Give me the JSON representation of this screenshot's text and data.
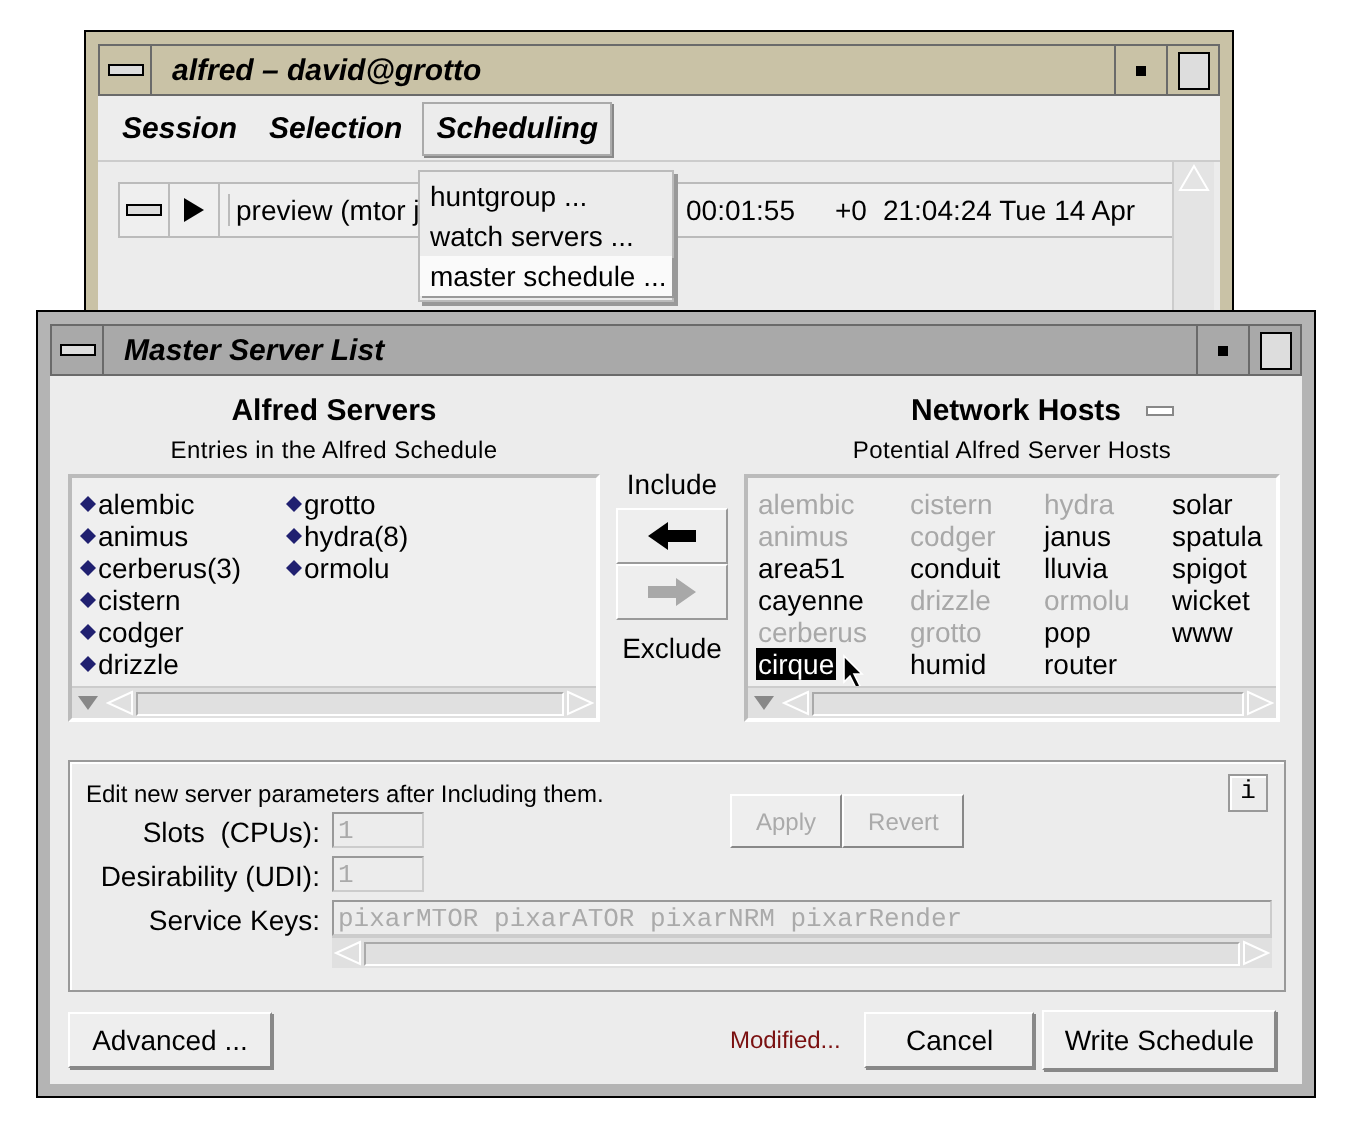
{
  "main_window": {
    "title": "alfred – david@grotto",
    "menus": [
      {
        "label": "Session",
        "open": false
      },
      {
        "label": "Selection",
        "open": false
      },
      {
        "label": "Scheduling",
        "open": true
      }
    ],
    "job": {
      "name": "preview (mtor j",
      "elapsed": "00:01:55",
      "offset": "+0",
      "timestamp": "21:04:24 Tue 14 Apr"
    },
    "dropdown": [
      {
        "label": "huntgroup ...",
        "selected": false
      },
      {
        "label": "watch servers ...",
        "selected": false
      },
      {
        "label": "master schedule ...",
        "selected": true
      }
    ]
  },
  "dialog": {
    "title": "Master Server List",
    "servers": {
      "title": "Alfred Servers",
      "subtitle": "Entries in the Alfred Schedule",
      "items": [
        "alembic",
        "animus",
        "cerberus(3)",
        "cistern",
        "codger",
        "drizzle",
        "grotto",
        "hydra(8)",
        "ormolu"
      ]
    },
    "transfer": {
      "include_label": "Include",
      "exclude_label": "Exclude",
      "buttons": [
        {
          "kind": "include",
          "disabled": false
        },
        {
          "kind": "exclude",
          "disabled": true
        }
      ]
    },
    "hosts": {
      "title": "Network Hosts",
      "subtitle": "Potential Alfred Server Hosts",
      "items": [
        {
          "label": "alembic",
          "disabled": true,
          "selected": false
        },
        {
          "label": "animus",
          "disabled": true,
          "selected": false
        },
        {
          "label": "area51",
          "disabled": false,
          "selected": false
        },
        {
          "label": "cayenne",
          "disabled": false,
          "selected": false
        },
        {
          "label": "cerberus",
          "disabled": true,
          "selected": false
        },
        {
          "label": "cirque",
          "disabled": false,
          "selected": true
        },
        {
          "label": "cistern",
          "disabled": true,
          "selected": false
        },
        {
          "label": "codger",
          "disabled": true,
          "selected": false
        },
        {
          "label": "conduit",
          "disabled": false,
          "selected": false
        },
        {
          "label": "drizzle",
          "disabled": true,
          "selected": false
        },
        {
          "label": "grotto",
          "disabled": true,
          "selected": false
        },
        {
          "label": "humid",
          "disabled": false,
          "selected": false
        },
        {
          "label": "hydra",
          "disabled": true,
          "selected": false
        },
        {
          "label": "janus",
          "disabled": false,
          "selected": false
        },
        {
          "label": "lluvia",
          "disabled": false,
          "selected": false
        },
        {
          "label": "ormolu",
          "disabled": true,
          "selected": false
        },
        {
          "label": "pop",
          "disabled": false,
          "selected": false
        },
        {
          "label": "router",
          "disabled": false,
          "selected": false
        },
        {
          "label": "solar",
          "disabled": false,
          "selected": false
        },
        {
          "label": "spatula",
          "disabled": false,
          "selected": false
        },
        {
          "label": "spigot",
          "disabled": false,
          "selected": false
        },
        {
          "label": "wicket",
          "disabled": false,
          "selected": false
        },
        {
          "label": "www",
          "disabled": false,
          "selected": false
        }
      ]
    },
    "params": {
      "note": "Edit new server parameters after Including them.",
      "info_button": "i",
      "fields": [
        {
          "label": "Slots  (CPUs):",
          "value": "1",
          "disabled": true
        },
        {
          "label": "Desirability (UDI):",
          "value": "1",
          "disabled": true
        }
      ],
      "buttons": [
        {
          "label": "Apply",
          "disabled": true
        },
        {
          "label": "Revert",
          "disabled": true
        }
      ],
      "service_keys": {
        "label": "Service Keys:",
        "value": "pixarMTOR pixarATOR pixarNRM pixarRender",
        "disabled": true
      }
    },
    "footer": {
      "advanced_button": "Advanced ...",
      "status": "Modified...",
      "buttons": [
        "Cancel",
        "Write Schedule"
      ]
    }
  }
}
